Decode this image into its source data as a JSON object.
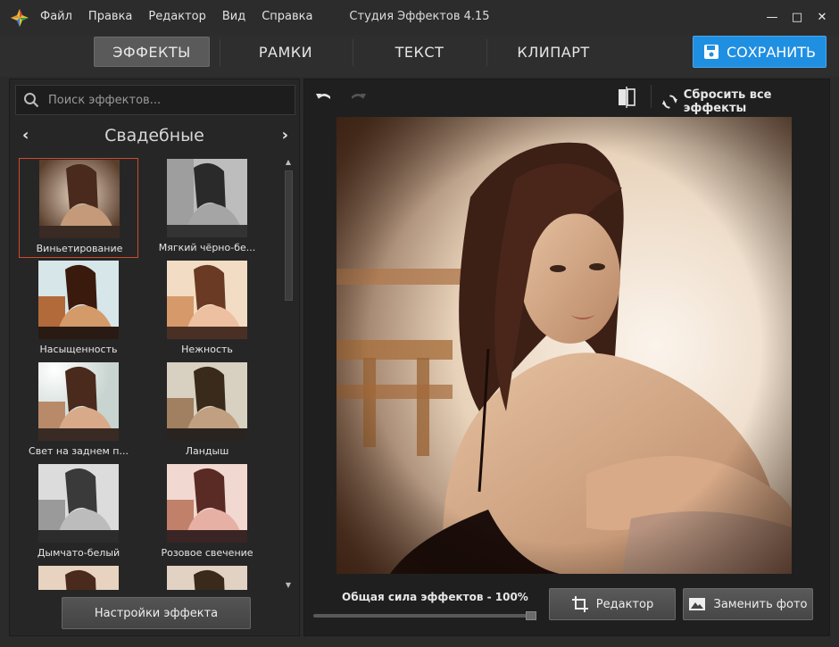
{
  "window": {
    "title": "Студия Эффектов 4.15",
    "menu": [
      "Файл",
      "Правка",
      "Редактор",
      "Вид",
      "Справка"
    ],
    "controls": {
      "minimize": "—",
      "maximize": "□",
      "close": "✕"
    }
  },
  "tabs": [
    "ЭФФЕКТЫ",
    "РАМКИ",
    "ТЕКСТ",
    "КЛИПАРТ"
  ],
  "active_tab": "ЭФФЕКТЫ",
  "save_label": "СОХРАНИТЬ",
  "search": {
    "placeholder": "Поиск эффектов..."
  },
  "category": {
    "title": "Свадебные",
    "prev": "‹",
    "next": "›"
  },
  "effects": [
    {
      "label": "Виньетирование",
      "selected": true
    },
    {
      "label": "Мягкий чёрно-бе..."
    },
    {
      "label": "Насыщенность"
    },
    {
      "label": "Нежность"
    },
    {
      "label": "Свет на заднем п..."
    },
    {
      "label": "Ландыш"
    },
    {
      "label": "Дымчато-белый"
    },
    {
      "label": "Розовое свечение"
    }
  ],
  "settings_label": "Настройки эффекта",
  "toolbar": {
    "reset_label": "Сбросить все эффекты",
    "icons": [
      "undo-icon",
      "redo-icon",
      "compare-icon",
      "reset-icon"
    ]
  },
  "strength": {
    "label": "Общая сила эффектов - 100%",
    "value_percent": 100
  },
  "editor_label": "Редактор",
  "replace_label": "Заменить фото",
  "colors": {
    "accent": "#1f8fe2",
    "selected_border": "#d24a2a",
    "bg": "#2b2b2b"
  }
}
